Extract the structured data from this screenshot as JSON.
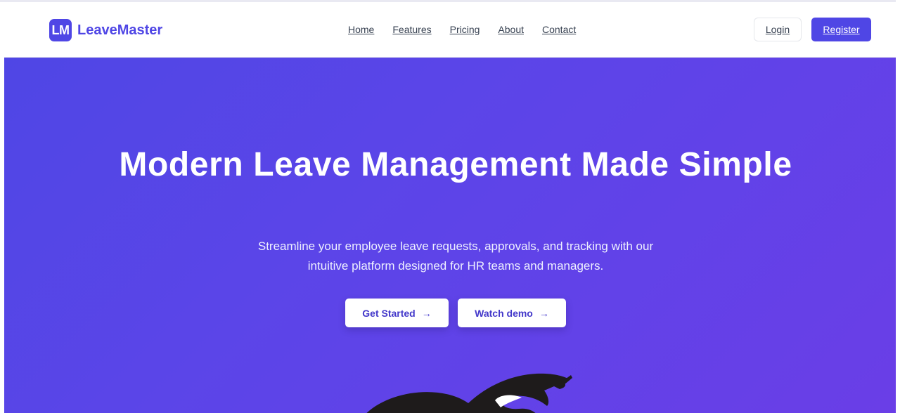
{
  "brand": {
    "logo_text": "LM",
    "name": "LeaveMaster"
  },
  "nav": {
    "items": [
      "Home",
      "Features",
      "Pricing",
      "About",
      "Contact"
    ]
  },
  "auth": {
    "login_label": "Login",
    "register_label": "Register"
  },
  "hero": {
    "title": "Modern Leave Management Made Simple",
    "subtitle": "Streamline your employee leave requests, approvals, and tracking with our intuitive platform designed for HR teams and managers.",
    "primary_cta": "Get Started",
    "secondary_cta": "Watch demo"
  },
  "icons": {
    "cta_arrow": "arrow-right-icon"
  },
  "colors": {
    "brand": "#4f46e5",
    "hero_start": "#4f46e5",
    "hero_end": "#6a3ee7",
    "cta_text": "#4338ca"
  }
}
